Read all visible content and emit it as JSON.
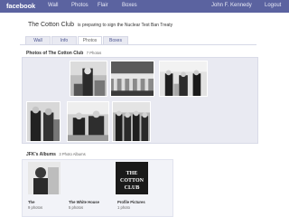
{
  "topbar": {
    "logo": "facebook",
    "nav": [
      "Wall",
      "Photos",
      "Flair",
      "Boxes"
    ],
    "user": "John F. Kennedy",
    "logout": "Logout"
  },
  "profile": {
    "name": "The Cotton Club",
    "status": "is preparing to sign the Nuclear Test Ban Treaty"
  },
  "tabs": [
    "Wall",
    "Info",
    "Photos",
    "Boxes"
  ],
  "active_tab": "Photos",
  "photos": {
    "title": "Photos of The Cotton Club",
    "count": "7 Photos"
  },
  "albums": {
    "title": "JFK's Albums",
    "count": "3 Photo Albums",
    "items": [
      {
        "label": "The",
        "count": "9 photos"
      },
      {
        "label": "The White House",
        "count": "5 photos"
      },
      {
        "label": "Profile Pictures",
        "count": "1 photo",
        "thumb_text": "THE COTTON CLUB"
      }
    ]
  }
}
